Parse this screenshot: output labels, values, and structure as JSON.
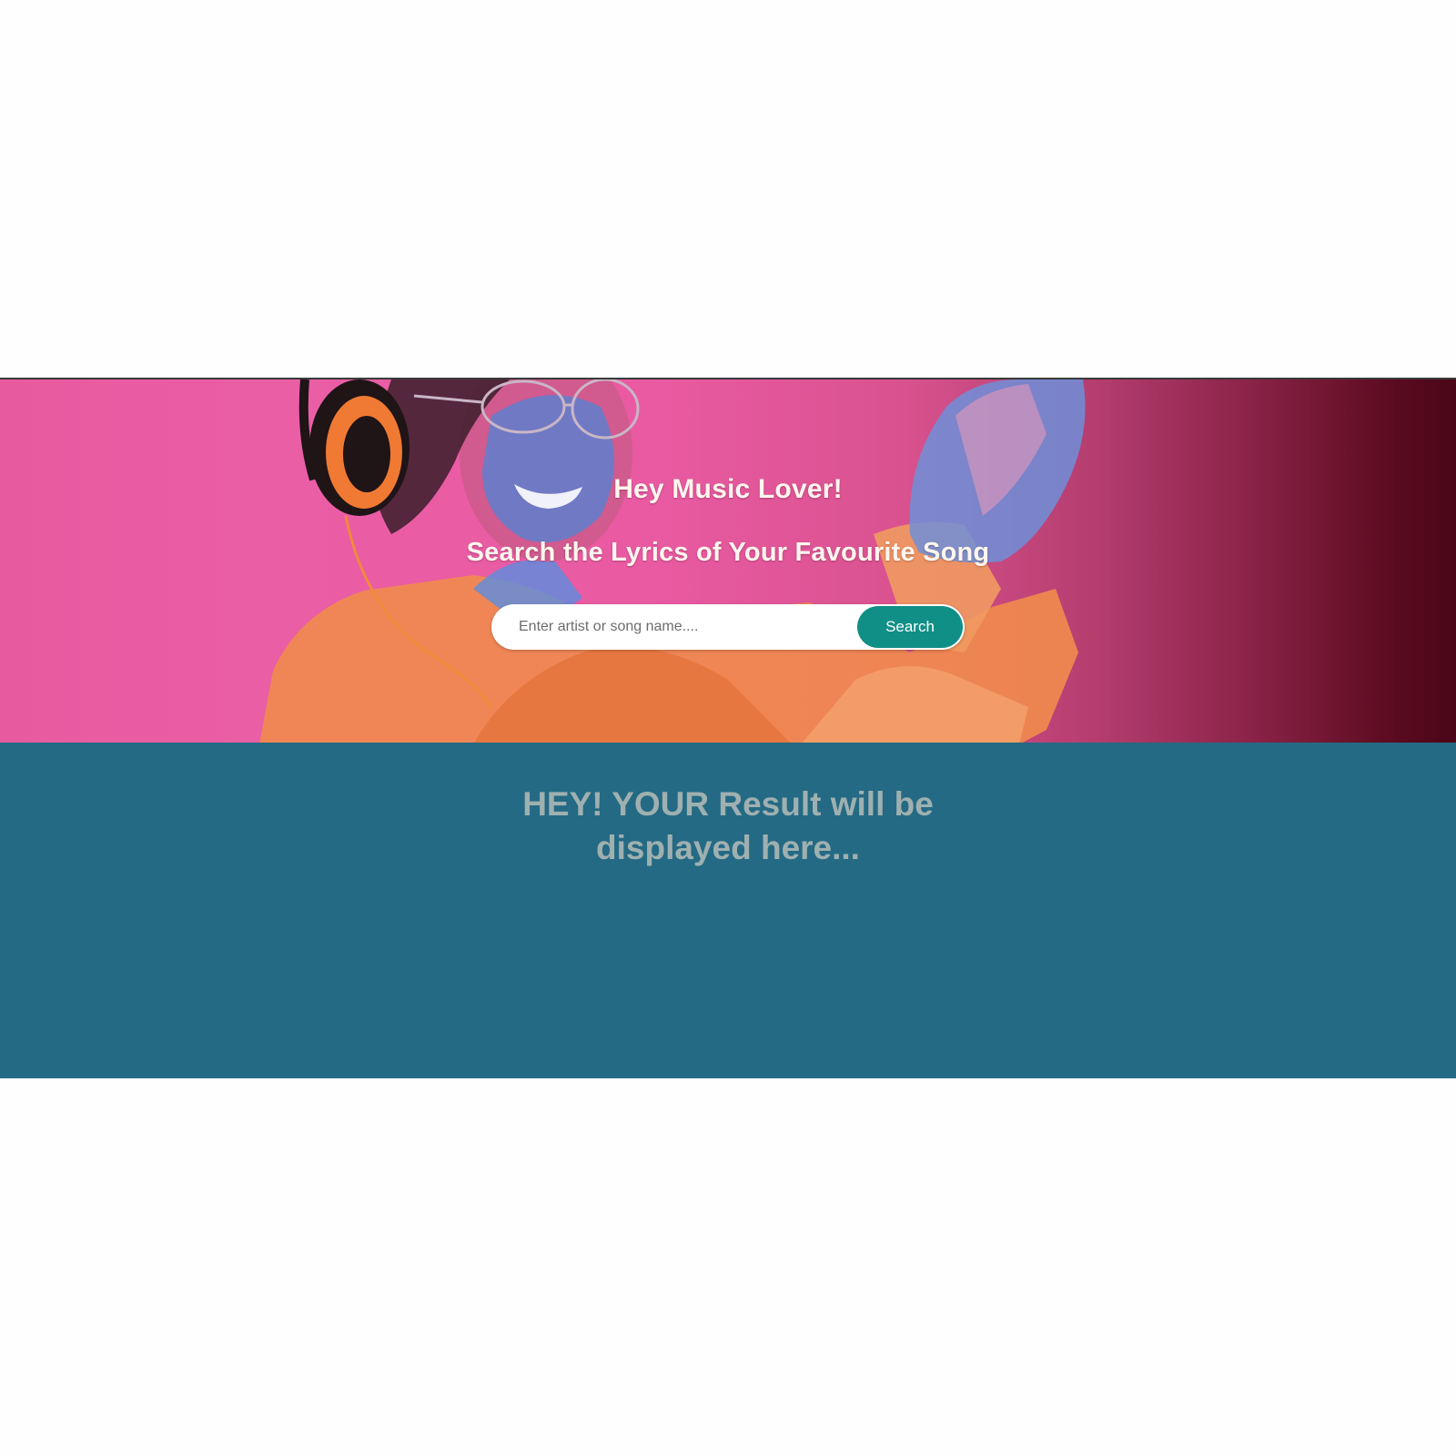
{
  "hero": {
    "title": "Hey Music Lover!",
    "subtitle": "Search the Lyrics of Your Favourite Song",
    "image": "woman-with-headphones-dancing"
  },
  "search": {
    "placeholder": "Enter artist or song name....",
    "value": "",
    "button_label": "Search"
  },
  "result": {
    "message": "HEY! YOUR Result will be displayed here..."
  },
  "colors": {
    "hero_pink": "#e95aa2",
    "hero_dark": "#4a0618",
    "button": "#108f86",
    "result_background": "#246a84",
    "result_text": "#9fb0b0",
    "heading_text": "#fff6ee"
  }
}
